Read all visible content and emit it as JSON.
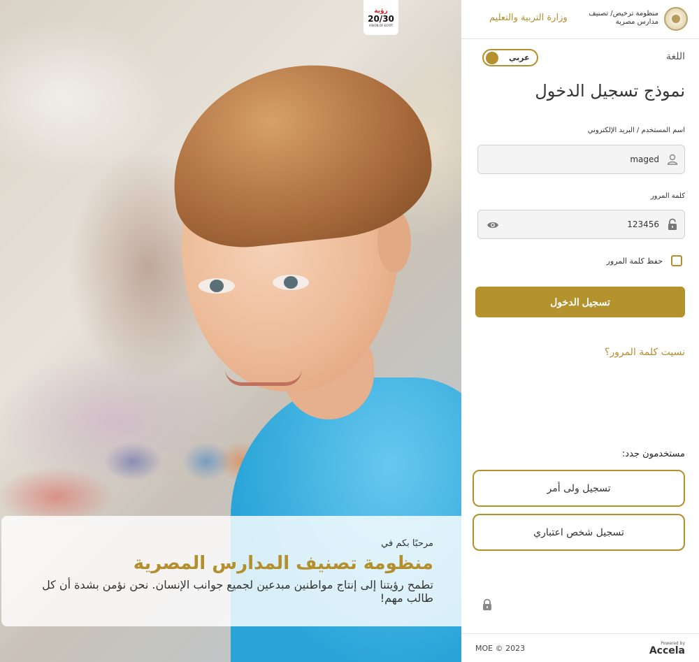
{
  "hero": {
    "vision_logo": {
      "top": "رؤية",
      "mid": "20/30",
      "bottom": "VISION OF EGYPT"
    },
    "welcome_small": "مرحبًا بكم في",
    "welcome_title": "منظومة تصنيف المدارس المصرية",
    "welcome_desc": "تطمح رؤيتنا إلى إنتاج مواطنين مبدعين لجميع جوانب الإنسان. نحن نؤمن بشدة أن كل طالب مهم!"
  },
  "header": {
    "system_name": "منظومة ترخيص/ تصنيف مدارس مصرية",
    "ministry_name": "وزارة التربية والتعليم"
  },
  "language": {
    "label": "اللغة",
    "toggle_text": "عربي"
  },
  "form": {
    "title": "نموذج تسجيل الدخول",
    "username_label": "اسم المستخدم / البريد الإلكتروني",
    "username_value": "maged",
    "password_label": "كلمة المرور",
    "password_value": "123456",
    "remember_label": "حفظ كلمة المرور",
    "login_button": "تسجيل الدخول",
    "forgot_link": "نسيت كلمة المرور؟"
  },
  "register": {
    "heading": "مستخدمون جدد:",
    "guardian_button": "تسجيل ولى أمر",
    "legal_entity_button": "تسجيل شخص اعتباري"
  },
  "footer": {
    "copyright": "MOE © 2023",
    "powered_by": "Powered by",
    "brand": "Accela"
  },
  "colors": {
    "accent": "#b4922e",
    "text": "#333333"
  }
}
